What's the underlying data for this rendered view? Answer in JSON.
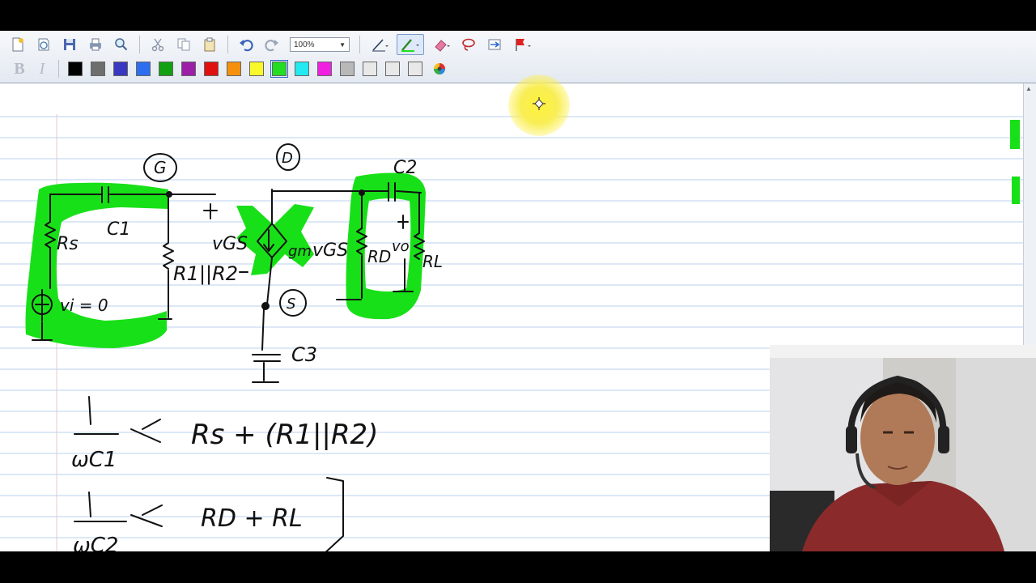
{
  "toolbar": {
    "zoom": "100%",
    "format_bold": "B",
    "format_italic": "I",
    "icons": [
      "new-page-icon",
      "settings-icon",
      "save-icon",
      "print-icon",
      "search-icon",
      "cut-icon",
      "copy-icon",
      "paste-icon",
      "undo-icon",
      "redo-icon"
    ],
    "tool_icons": [
      "pen-icon",
      "highlighter-icon",
      "eraser-icon",
      "lasso-icon",
      "insert-space-icon",
      "flag-icon"
    ],
    "colors": [
      "#000000",
      "#6e6e6e",
      "#3838c0",
      "#2d6ef0",
      "#12a012",
      "#9b1fa8",
      "#e01010",
      "#f4900c",
      "#f8f82a",
      "#22dd22",
      "#22e8f0",
      "#f020e0",
      "#b8b8b8",
      "#e8e8e8",
      "#e8e8e8",
      "#e8e8e8"
    ]
  },
  "whiteboard": {
    "node_gate": "G",
    "node_drain": "D",
    "node_source": "S",
    "cap_c1": "C1",
    "cap_c2": "C2",
    "cap_c3": "C3",
    "res_rs": "Rs",
    "res_r12": "R1||R2",
    "res_rd": "RD",
    "res_rl": "RL",
    "source_vi": "vi = 0",
    "vgs_left": "vGS",
    "vgs_right": "vGS",
    "gm_label": "gm",
    "vo_label": "vo",
    "eq1_rhs": "Rs + (R1||R2)",
    "eq2_rhs": "RD + RL",
    "eq_numerator": "1",
    "eq1_den": "ωC1",
    "eq2_den": "ωC2",
    "eq_op": "<<"
  }
}
